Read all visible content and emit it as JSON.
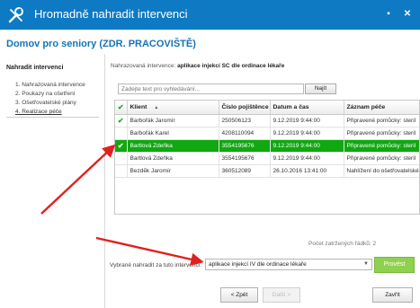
{
  "window": {
    "title": "Hromadně nahradit intervenci",
    "app_icon": "wrench-screwdriver-icon",
    "controls": [
      "menu-icon",
      "close-icon"
    ]
  },
  "context": {
    "title": "Domov pro seniory",
    "suffix": "(ZDR. PRACOVIŠTĚ)"
  },
  "sidebar": {
    "title": "Nahradit intervenci",
    "steps": [
      "1. Nahrazovaná intervence",
      "2. Poukazy na ošetření",
      "3. Ošetřovatelské plány",
      "4. Realizace péče"
    ]
  },
  "replaced": {
    "label": "Nahrazovaná intervence:",
    "value": "aplikace injekcí SC dle ordinace lékaře"
  },
  "search": {
    "placeholder": "Zadejte text pro vyhledávání...",
    "button_label": "Najít"
  },
  "table": {
    "columns": [
      "Klient",
      "Číslo pojištěnce",
      "Datum a čas",
      "Záznam péče"
    ],
    "rows": [
      {
        "checked": true,
        "klient": "Barbořák Jaromír",
        "cislo": "250506123",
        "datum": "9.12.2019 9:44:00",
        "zaznam": "Připravené pomůcky: steril"
      },
      {
        "checked": false,
        "klient": "Barbořák Karel",
        "cislo": "4208110094",
        "datum": "9.12.2019 9:44:00",
        "zaznam": "Připravené pomůcky: steril"
      },
      {
        "checked": true,
        "klient": "Bartlová Zdeňka",
        "cislo": "3554195676",
        "datum": "9.12.2019 9:44:00",
        "zaznam": "Připravené pomůcky: steril",
        "selected": true
      },
      {
        "checked": false,
        "klient": "Bartlová Zdeňka",
        "cislo": "3554195676",
        "datum": "9.12.2019 9:44:00",
        "zaznam": "Připravené pomůcky: steril"
      },
      {
        "checked": false,
        "klient": "Bezdĕk Jaromír",
        "cislo": "360512089",
        "datum": "26.10.2016 13:41:00",
        "zaznam": "Nahlížení do ošetřovatelské"
      }
    ]
  },
  "row_count": "Počet zatržených řádků: 2",
  "replacement": {
    "label": "Vybrané nahradit za tuto intervenci:",
    "selected": "aplikace injekcí IV dle ordinace lékaře",
    "apply_label": "Provést"
  },
  "nav": {
    "back_label": "< Zpět",
    "next_label": "Další >",
    "close_label": "Zavřít"
  },
  "colors": {
    "titlebar": "#0e7ac4",
    "accent": "#1673b8",
    "selected_row": "#10a810",
    "apply_button": "#8fd14f",
    "annotation_arrow": "#e02020"
  }
}
